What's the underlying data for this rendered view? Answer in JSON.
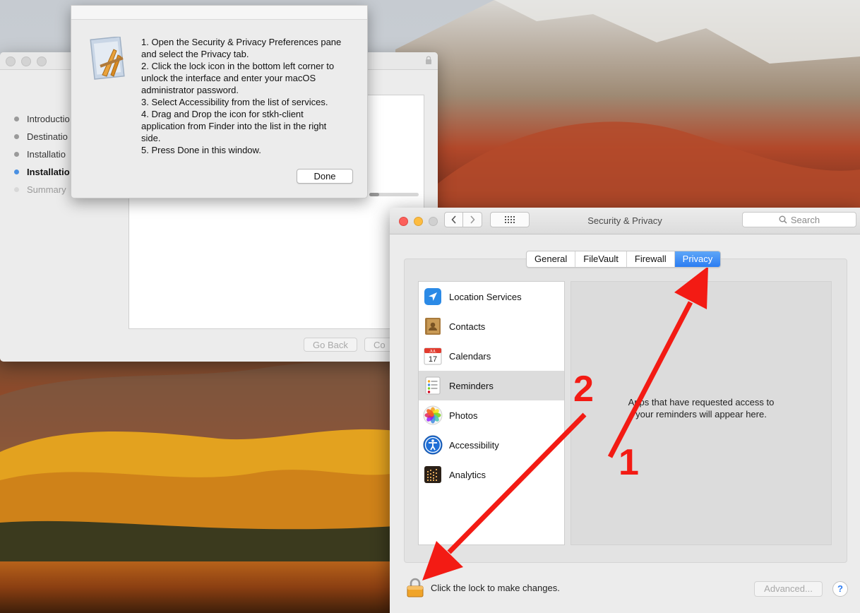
{
  "installer": {
    "steps": [
      {
        "label": "Introductio"
      },
      {
        "label": "Destinatio"
      },
      {
        "label": "Installatio"
      },
      {
        "label": "Installatio"
      },
      {
        "label": "Summary"
      }
    ],
    "buttons": {
      "back": "Go Back",
      "continue": "Co"
    }
  },
  "sheet": {
    "lines": [
      "1. Open the Security & Privacy Preferences pane",
      "and select the Privacy tab.",
      "2. Click the lock icon in the bottom left corner to",
      "unlock the interface and enter your macOS",
      "administrator password.",
      "3. Select Accessibility from the list of services.",
      "4. Drag and Drop the icon for stkh-client",
      "application from Finder into the list in the right",
      "side.",
      "5. Press Done in this window."
    ],
    "done": "Done"
  },
  "prefs": {
    "title": "Security & Privacy",
    "search_placeholder": "Search",
    "tabs": [
      "General",
      "FileVault",
      "Firewall",
      "Privacy"
    ],
    "active_tab": "Privacy",
    "services": [
      {
        "label": "Location Services",
        "icon": "location-arrow-icon"
      },
      {
        "label": "Contacts",
        "icon": "contacts-book-icon"
      },
      {
        "label": "Calendars",
        "icon": "calendar-icon"
      },
      {
        "label": "Reminders",
        "icon": "reminders-list-icon"
      },
      {
        "label": "Photos",
        "icon": "photos-flower-icon"
      },
      {
        "label": "Accessibility",
        "icon": "accessibility-figure-icon"
      },
      {
        "label": "Analytics",
        "icon": "analytics-grid-icon"
      }
    ],
    "selected_service": "Reminders",
    "calendar_month": "JUL",
    "calendar_day": "17",
    "detail_message": "Apps that have requested access to your reminders will appear here.",
    "lock_label": "Click the lock to make changes.",
    "advanced": "Advanced...",
    "help": "?"
  },
  "annotations": {
    "one": "1",
    "two": "2",
    "color": "#f31b14"
  }
}
